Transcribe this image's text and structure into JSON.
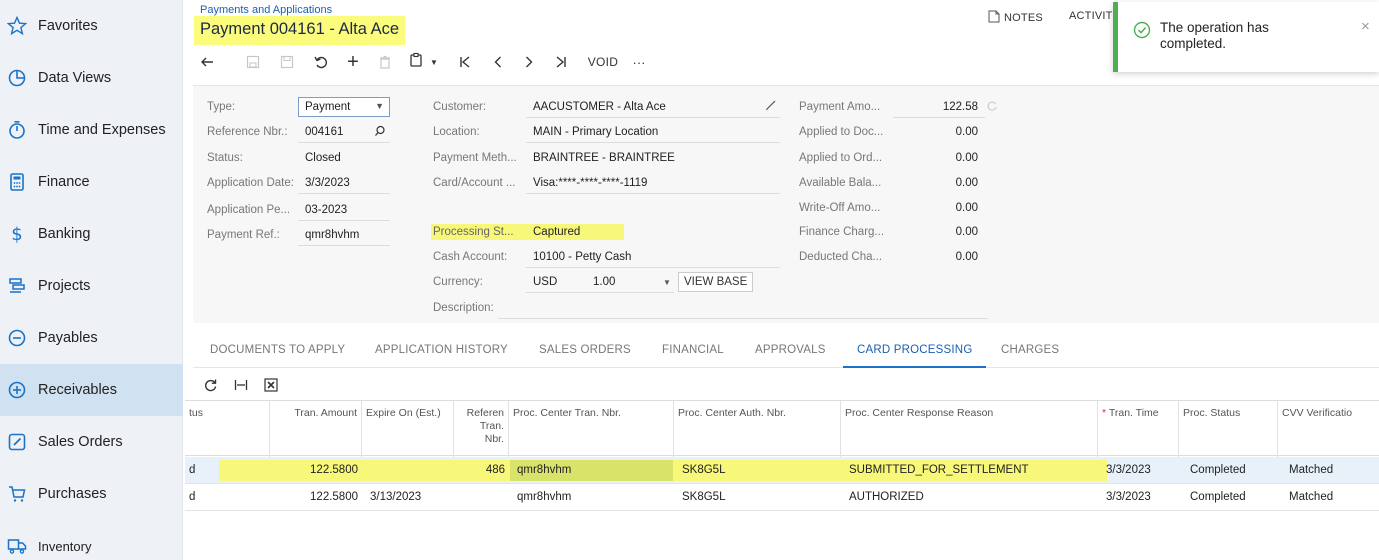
{
  "sidebar": {
    "items": [
      {
        "label": "Favorites",
        "icon": "star-icon"
      },
      {
        "label": "Data Views",
        "icon": "pie-chart-icon"
      },
      {
        "label": "Time and Expenses",
        "icon": "stopwatch-icon"
      },
      {
        "label": "Finance",
        "icon": "calculator-icon"
      },
      {
        "label": "Banking",
        "icon": "dollar-icon"
      },
      {
        "label": "Projects",
        "icon": "projects-icon"
      },
      {
        "label": "Payables",
        "icon": "minus-circle-icon"
      },
      {
        "label": "Receivables",
        "icon": "plus-circle-icon"
      },
      {
        "label": "Sales Orders",
        "icon": "pencil-square-icon"
      },
      {
        "label": "Purchases",
        "icon": "cart-icon"
      },
      {
        "label": "Inventory",
        "icon": "truck-icon"
      }
    ],
    "active": "Receivables"
  },
  "header": {
    "breadcrumb": "Payments and Applications",
    "title": "Payment 004161 - Alta Ace",
    "notes": "NOTES",
    "activities": "ACTIVITI"
  },
  "toast": {
    "message": "The operation has completed.",
    "close": "×"
  },
  "toolbar": {
    "void": "VOID",
    "more": "···"
  },
  "form": {
    "col1": {
      "type_label": "Type:",
      "type_value": "Payment",
      "ref_label": "Reference Nbr.:",
      "ref_value": "004161",
      "status_label": "Status:",
      "status_value": "Closed",
      "appdate_label": "Application Date:",
      "appdate_value": "3/3/2023",
      "appperiod_label": "Application Pe...",
      "appperiod_value": "03-2023",
      "payref_label": "Payment Ref.:",
      "payref_value": "qmr8hvhm"
    },
    "col2": {
      "customer_label": "Customer:",
      "customer_value": "AACUSTOMER - Alta Ace",
      "location_label": "Location:",
      "location_value": "MAIN - Primary Location",
      "paymeth_label": "Payment Meth...",
      "paymeth_value": "BRAINTREE - BRAINTREE",
      "card_label": "Card/Account ...",
      "card_value": "Visa:****-****-****-1119",
      "procstatus_label": "Processing St...",
      "procstatus_value": "Captured",
      "cash_label": "Cash Account:",
      "cash_value": "10100 - Petty Cash",
      "currency_label": "Currency:",
      "currency_value": "USD",
      "rate_value": "1.00",
      "view_base": "VIEW BASE",
      "desc_label": "Description:",
      "desc_value": ""
    },
    "col3": {
      "payamt_label": "Payment Amo...",
      "payamt_value": "122.58",
      "applieddoc_label": "Applied to Doc...",
      "applieddoc_value": "0.00",
      "appliedord_label": "Applied to Ord...",
      "appliedord_value": "0.00",
      "avail_label": "Available Bala...",
      "avail_value": "0.00",
      "writeoff_label": "Write-Off Amo...",
      "writeoff_value": "0.00",
      "finance_label": "Finance Charg...",
      "finance_value": "0.00",
      "deducted_label": "Deducted Cha...",
      "deducted_value": "0.00"
    }
  },
  "tabs": [
    {
      "label": "DOCUMENTS TO APPLY"
    },
    {
      "label": "APPLICATION HISTORY"
    },
    {
      "label": "SALES ORDERS"
    },
    {
      "label": "FINANCIAL"
    },
    {
      "label": "APPROVALS"
    },
    {
      "label": "CARD PROCESSING"
    },
    {
      "label": "CHARGES"
    }
  ],
  "active_tab": "CARD PROCESSING",
  "grid": {
    "columns": [
      {
        "label": "tus"
      },
      {
        "label": "Tran. Amount"
      },
      {
        "label": "Expire On (Est.)"
      },
      {
        "label": "Referen Tran. Nbr."
      },
      {
        "label": "Proc. Center Tran. Nbr."
      },
      {
        "label": "Proc. Center Auth. Nbr."
      },
      {
        "label": "Proc. Center Response Reason"
      },
      {
        "label": "Tran. Time",
        "required": "*"
      },
      {
        "label": "Proc. Status"
      },
      {
        "label": "CVV Verificatio"
      }
    ],
    "rows": [
      [
        "d",
        "122.5800",
        "",
        "486",
        "qmr8hvhm",
        "SK8G5L",
        "SUBMITTED_FOR_SETTLEMENT",
        "3/3/2023",
        "Completed",
        "Matched"
      ],
      [
        "d",
        "122.5800",
        "3/13/2023",
        "",
        "qmr8hvhm",
        "SK8G5L",
        "AUTHORIZED",
        "3/3/2023",
        "Completed",
        "Matched"
      ]
    ]
  },
  "colors": {
    "accent": "#1a73c7",
    "highlight": "#f7f77a",
    "toast_green": "#4caf50",
    "sidebar_bg": "#eef1f6",
    "sidebar_active": "#d0e1f2"
  }
}
